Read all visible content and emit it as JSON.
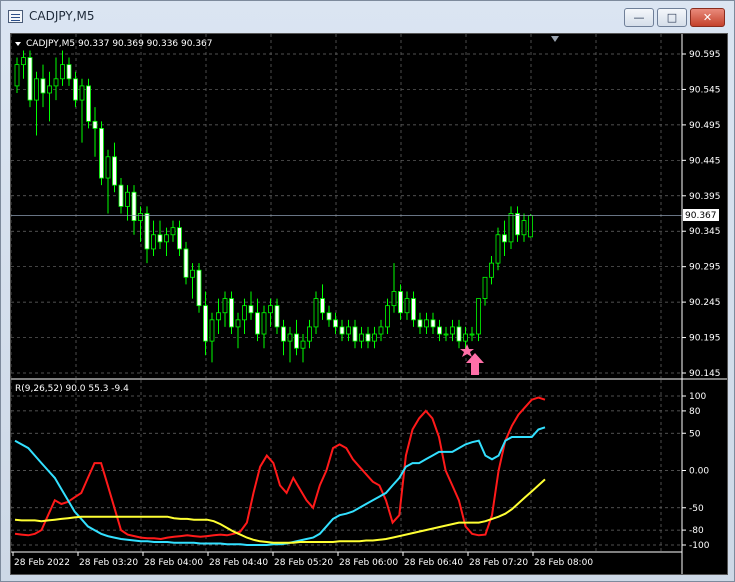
{
  "window": {
    "title": "CADJPY,M5",
    "controls": {
      "minimize": "—",
      "maximize": "□",
      "close": "✕"
    }
  },
  "chart": {
    "header": "CADJPY,M5  90.337 90.369 90.336 90.367",
    "current_price_label": "90.367",
    "price_ticks": [
      "90.595",
      "90.545",
      "90.495",
      "90.445",
      "90.395",
      "90.345",
      "90.295",
      "90.245",
      "90.195",
      "90.145"
    ],
    "time_labels": [
      "28 Feb 2022",
      "28 Feb 03:20",
      "28 Feb 04:00",
      "28 Feb 04:40",
      "28 Feb 05:20",
      "28 Feb 06:00",
      "28 Feb 06:40",
      "28 Feb 07:20",
      "28 Feb 08:00"
    ],
    "indicator_header": "R(9,26,52) 90.0 55.3 -9.4",
    "indicator_ticks": [
      "100",
      "80",
      "50",
      "0.00",
      "-50",
      "-80",
      "-100"
    ],
    "colors": {
      "bull_candle": "#00ff00",
      "bear_candle": "#ffffff",
      "grid": "#6b6b6b",
      "background": "#000000",
      "line_red": "#ff1a1a",
      "line_cyan": "#33e0ff",
      "line_yellow": "#ffff33",
      "signal": "#ff6fa8"
    },
    "signal_markers": {
      "star_icon": "star-icon",
      "arrow_icon": "up-arrow-icon"
    }
  },
  "chart_data": [
    {
      "type": "candlestick",
      "symbol": "CADJPY",
      "timeframe": "M5",
      "ylim": [
        90.145,
        90.595
      ],
      "ohlc": [
        [
          90.55,
          90.59,
          90.54,
          90.58
        ],
        [
          90.58,
          90.6,
          90.56,
          90.59
        ],
        [
          90.59,
          90.6,
          90.52,
          90.53
        ],
        [
          90.53,
          90.57,
          90.48,
          90.56
        ],
        [
          90.56,
          90.58,
          90.52,
          90.54
        ],
        [
          90.54,
          90.57,
          90.5,
          90.55
        ],
        [
          90.55,
          90.59,
          90.53,
          90.56
        ],
        [
          90.56,
          90.6,
          90.55,
          90.58
        ],
        [
          90.58,
          90.59,
          90.55,
          90.56
        ],
        [
          90.56,
          90.57,
          90.52,
          90.53
        ],
        [
          90.53,
          90.56,
          90.47,
          90.55
        ],
        [
          90.55,
          90.56,
          90.49,
          90.5
        ],
        [
          90.5,
          90.52,
          90.45,
          90.49
        ],
        [
          90.49,
          90.5,
          90.41,
          90.42
        ],
        [
          90.42,
          90.46,
          90.37,
          90.45
        ],
        [
          90.45,
          90.47,
          90.4,
          90.41
        ],
        [
          90.41,
          90.42,
          90.37,
          90.38
        ],
        [
          90.38,
          90.41,
          90.36,
          90.4
        ],
        [
          90.4,
          90.41,
          90.34,
          90.36
        ],
        [
          90.36,
          90.38,
          90.33,
          90.37
        ],
        [
          90.37,
          90.38,
          90.3,
          90.32
        ],
        [
          90.32,
          90.36,
          90.31,
          90.34
        ],
        [
          90.34,
          90.36,
          90.32,
          90.33
        ],
        [
          90.33,
          90.35,
          90.31,
          90.34
        ],
        [
          90.34,
          90.36,
          90.33,
          90.35
        ],
        [
          90.35,
          90.36,
          90.31,
          90.32
        ],
        [
          90.32,
          90.33,
          90.27,
          90.28
        ],
        [
          90.28,
          90.3,
          90.25,
          90.29
        ],
        [
          90.29,
          90.3,
          90.23,
          90.24
        ],
        [
          90.24,
          90.26,
          90.17,
          90.19
        ],
        [
          90.19,
          90.23,
          90.16,
          90.22
        ],
        [
          90.22,
          90.25,
          90.2,
          90.23
        ],
        [
          90.23,
          90.26,
          90.21,
          90.25
        ],
        [
          90.25,
          90.26,
          90.2,
          90.21
        ],
        [
          90.21,
          90.23,
          90.18,
          90.22
        ],
        [
          90.22,
          90.25,
          90.2,
          90.24
        ],
        [
          90.24,
          90.26,
          90.22,
          90.23
        ],
        [
          90.23,
          90.25,
          90.19,
          90.2
        ],
        [
          90.2,
          90.24,
          90.18,
          90.23
        ],
        [
          90.23,
          90.25,
          90.21,
          90.24
        ],
        [
          90.24,
          90.25,
          90.2,
          90.21
        ],
        [
          90.21,
          90.22,
          90.17,
          90.19
        ],
        [
          90.19,
          90.21,
          90.16,
          90.2
        ],
        [
          90.2,
          90.22,
          90.17,
          90.18
        ],
        [
          90.18,
          90.2,
          90.16,
          90.19
        ],
        [
          90.19,
          90.22,
          90.18,
          90.21
        ],
        [
          90.21,
          90.26,
          90.2,
          90.25
        ],
        [
          90.25,
          90.27,
          90.22,
          90.23
        ],
        [
          90.23,
          90.24,
          90.21,
          90.22
        ],
        [
          90.22,
          90.23,
          90.2,
          90.21
        ],
        [
          90.21,
          90.22,
          90.19,
          90.2
        ],
        [
          90.2,
          90.22,
          90.19,
          90.21
        ],
        [
          90.21,
          90.22,
          90.18,
          90.19
        ],
        [
          90.19,
          90.21,
          90.18,
          90.2
        ],
        [
          90.2,
          90.21,
          90.18,
          90.19
        ],
        [
          90.19,
          90.21,
          90.18,
          90.2
        ],
        [
          90.2,
          90.22,
          90.19,
          90.21
        ],
        [
          90.21,
          90.25,
          90.2,
          90.24
        ],
        [
          90.24,
          90.3,
          90.23,
          90.26
        ],
        [
          90.26,
          90.27,
          90.22,
          90.23
        ],
        [
          90.23,
          90.26,
          90.22,
          90.25
        ],
        [
          90.25,
          90.26,
          90.21,
          90.22
        ],
        [
          90.22,
          90.23,
          90.2,
          90.21
        ],
        [
          90.21,
          90.23,
          90.2,
          90.22
        ],
        [
          90.22,
          90.23,
          90.2,
          90.21
        ],
        [
          90.21,
          90.22,
          90.19,
          90.2
        ],
        [
          90.2,
          90.21,
          90.19,
          90.2
        ],
        [
          90.2,
          90.22,
          90.19,
          90.21
        ],
        [
          90.21,
          90.22,
          90.18,
          90.19
        ],
        [
          90.19,
          90.21,
          90.18,
          90.2
        ],
        [
          90.2,
          90.21,
          90.19,
          90.2
        ],
        [
          90.2,
          90.25,
          90.19,
          90.25
        ],
        [
          90.25,
          90.28,
          90.24,
          90.28
        ],
        [
          90.28,
          90.31,
          90.27,
          90.3
        ],
        [
          90.3,
          90.35,
          90.29,
          90.34
        ],
        [
          90.34,
          90.36,
          90.31,
          90.33
        ],
        [
          90.33,
          90.38,
          90.32,
          90.37
        ],
        [
          90.37,
          90.38,
          90.33,
          90.34
        ],
        [
          90.34,
          90.37,
          90.33,
          90.36
        ],
        [
          90.337,
          90.369,
          90.336,
          90.367
        ]
      ],
      "current_price": 90.367
    },
    {
      "type": "line",
      "title": "R(9,26,52) 90.0 55.3 -9.4",
      "ylim": [
        -100,
        100
      ],
      "series": [
        {
          "color": "#ff1a1a",
          "values": [
            -85,
            -86,
            -87,
            -85,
            -80,
            -60,
            -40,
            -45,
            -42,
            -36,
            -30,
            -10,
            10,
            10,
            -20,
            -50,
            -80,
            -86,
            -88,
            -90,
            -91,
            -91,
            -92,
            -90,
            -89,
            -88,
            -87,
            -88,
            -89,
            -88,
            -87,
            -86,
            -87,
            -85,
            -82,
            -70,
            -30,
            5,
            20,
            10,
            -20,
            -30,
            -10,
            -25,
            -40,
            -50,
            -20,
            0,
            30,
            35,
            30,
            15,
            5,
            -5,
            -15,
            -20,
            -40,
            -70,
            -60,
            20,
            55,
            70,
            80,
            70,
            45,
            0,
            -20,
            -40,
            -75,
            -85,
            -87,
            -86,
            -60,
            0,
            40,
            60,
            75,
            85,
            95,
            98,
            95
          ]
        },
        {
          "color": "#33e0ff",
          "values": [
            40,
            35,
            30,
            20,
            10,
            0,
            -10,
            -25,
            -40,
            -55,
            -65,
            -75,
            -80,
            -85,
            -88,
            -90,
            -92,
            -93,
            -94,
            -95,
            -95,
            -96,
            -96,
            -96,
            -97,
            -97,
            -97,
            -97,
            -98,
            -98,
            -98,
            -98,
            -99,
            -99,
            -99,
            -100,
            -100,
            -100,
            -100,
            -99,
            -99,
            -98,
            -96,
            -94,
            -92,
            -90,
            -85,
            -75,
            -65,
            -60,
            -58,
            -55,
            -50,
            -45,
            -40,
            -35,
            -30,
            -20,
            -10,
            5,
            10,
            10,
            15,
            20,
            25,
            25,
            25,
            30,
            35,
            38,
            40,
            20,
            15,
            20,
            40,
            45,
            45,
            45,
            45,
            55,
            58
          ]
        },
        {
          "color": "#ffff33",
          "values": [
            -66,
            -67,
            -67,
            -67,
            -68,
            -67,
            -66,
            -65,
            -64,
            -63,
            -62,
            -62,
            -62,
            -62,
            -62,
            -62,
            -62,
            -62,
            -62,
            -62,
            -62,
            -62,
            -62,
            -62,
            -64,
            -65,
            -65,
            -66,
            -66,
            -66,
            -68,
            -72,
            -77,
            -82,
            -86,
            -90,
            -93,
            -95,
            -96,
            -97,
            -97,
            -97,
            -97,
            -96,
            -96,
            -96,
            -96,
            -96,
            -96,
            -95,
            -95,
            -95,
            -95,
            -94,
            -94,
            -93,
            -92,
            -90,
            -88,
            -86,
            -84,
            -82,
            -80,
            -78,
            -76,
            -74,
            -72,
            -70,
            -70,
            -70,
            -70,
            -68,
            -65,
            -62,
            -58,
            -52,
            -44,
            -36,
            -28,
            -20,
            -12
          ]
        }
      ]
    }
  ]
}
